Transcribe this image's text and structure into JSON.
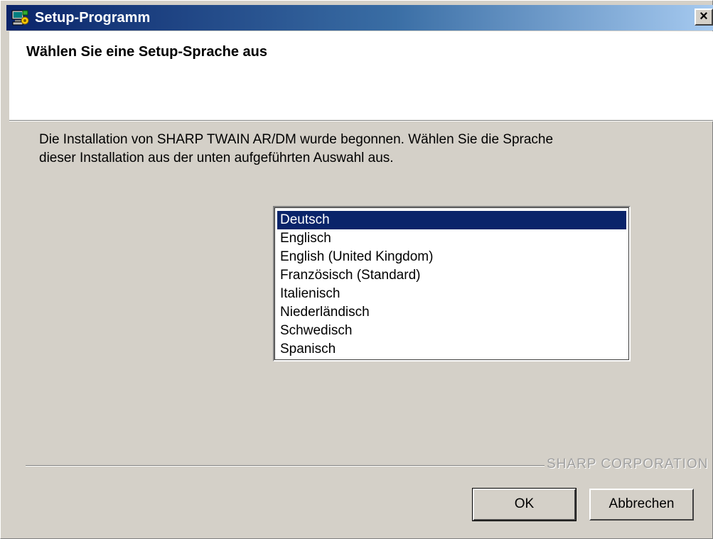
{
  "window": {
    "title": "Setup-Programm",
    "close_glyph": "×"
  },
  "header": {
    "title": "Wählen Sie eine Setup-Sprache aus"
  },
  "instructions": {
    "line1": "Die Installation von SHARP TWAIN AR/DM wurde begonnen.  Wählen Sie die Sprache",
    "line2": "dieser Installation aus der unten aufgeführten Auswahl aus."
  },
  "languages": {
    "selected_index": 0,
    "items": [
      "Deutsch",
      "Englisch",
      "English (United Kingdom)",
      "Französisch (Standard)",
      "Italienisch",
      "Niederländisch",
      "Schwedisch",
      "Spanisch"
    ]
  },
  "footer": {
    "brand": "SHARP CORPORATION",
    "ok_label": "OK",
    "cancel_label": "Abbrechen"
  },
  "colors": {
    "title_gradient_start": "#0a246a",
    "title_gradient_end": "#a6caf0",
    "selection": "#0a246a",
    "dialog_face": "#d4d0c8"
  },
  "icons": {
    "app": "setup-computer-icon",
    "close": "close-icon"
  }
}
